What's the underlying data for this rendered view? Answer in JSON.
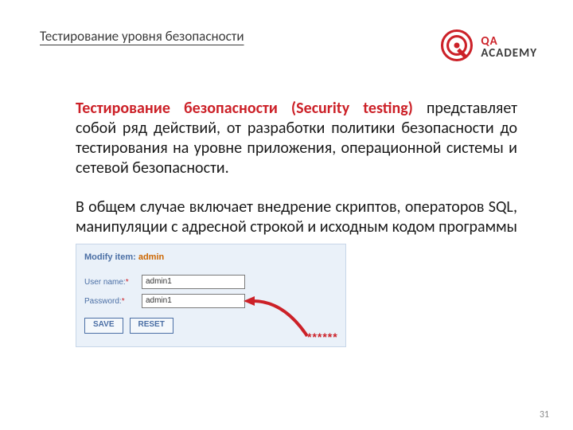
{
  "header": {
    "title": "Тестирование уровня безопасности",
    "logo": {
      "qa": "QA",
      "academy": "ACADEMY"
    }
  },
  "body": {
    "accent_phrase": "Тестирование безопасности (Security testing)",
    "para1_rest": " представляет собой ряд действий, от разработки политики безопасности до тестирования на уровне приложения, операционной системы и сетевой безопасности.",
    "para2": "В общем случае включает внедрение скриптов, операторов SQL, манипуляции с адресной строкой и исходным кодом программы"
  },
  "form": {
    "modify_label": "Modify item:",
    "modify_value": "admin",
    "username_label": "User name:",
    "username_value": "admin1",
    "password_label": "Password:",
    "password_value": "admin1",
    "save": "SAVE",
    "reset": "RESET",
    "mask": "******"
  },
  "page_number": "31",
  "colors": {
    "accent": "#cc2128",
    "text": "#1a1a1a",
    "link": "#4b6fa5"
  }
}
